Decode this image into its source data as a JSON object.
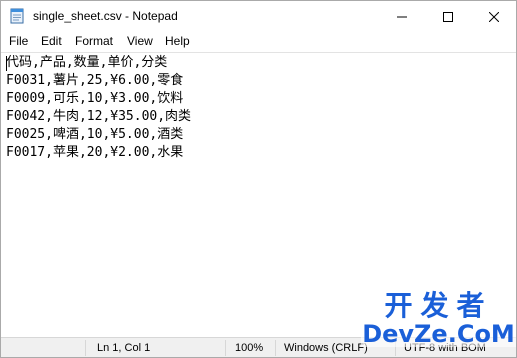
{
  "window": {
    "title": "single_sheet.csv - Notepad",
    "app_icon": "notepad-icon"
  },
  "menu": {
    "items": [
      "File",
      "Edit",
      "Format",
      "View",
      "Help"
    ]
  },
  "editor": {
    "lines": [
      "代码,产品,数量,单价,分类",
      "F0031,薯片,25,¥6.00,零食",
      "F0009,可乐,10,¥3.00,饮料",
      "F0042,牛肉,12,¥35.00,肉类",
      "F0025,啤酒,10,¥5.00,酒类",
      "F0017,苹果,20,¥2.00,水果"
    ]
  },
  "status": {
    "position": "Ln 1, Col 1",
    "zoom": "100%",
    "line_ending": "Windows (CRLF)",
    "encoding": "UTF-8 with BOM"
  },
  "watermark": {
    "top": "开发者",
    "bottom": "DevZe.CoM"
  },
  "colors": {
    "watermark": "#1a5fd8",
    "statusbar": "#f0f0f0"
  }
}
